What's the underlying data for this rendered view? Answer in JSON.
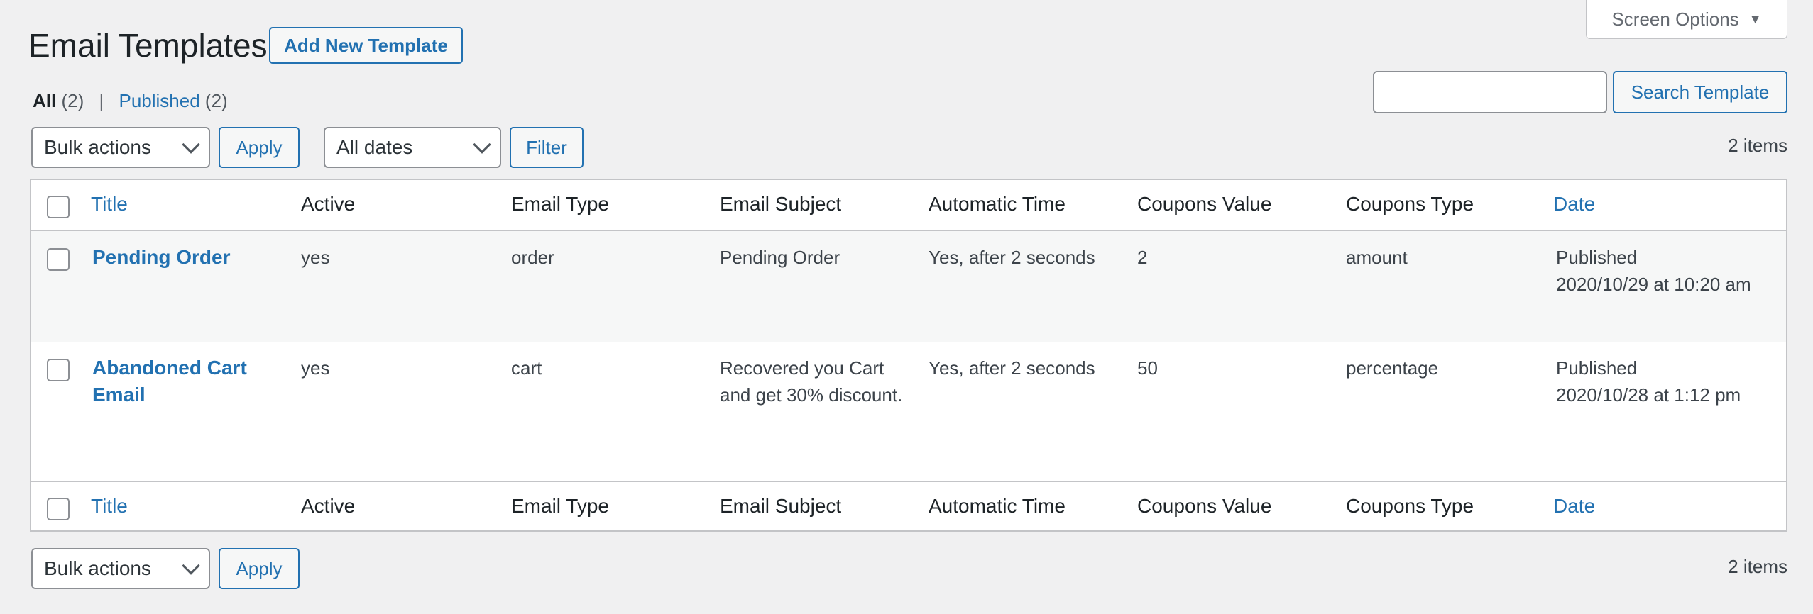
{
  "screen_options": {
    "label": "Screen Options",
    "arrow": "▼"
  },
  "page": {
    "title": "Email Templates",
    "add_new_label": "Add New Template"
  },
  "views": {
    "all_label": "All",
    "all_count": "(2)",
    "separator": "|",
    "published_label": "Published",
    "published_count": "(2)"
  },
  "search": {
    "value": "",
    "button_label": "Search Template"
  },
  "tablenav_top": {
    "bulk_actions": "Bulk actions",
    "apply_label": "Apply",
    "dates_filter": "All dates",
    "filter_label": "Filter",
    "items_count": "2 items"
  },
  "table": {
    "columns": {
      "title": "Title",
      "active": "Active",
      "email_type": "Email Type",
      "email_subject": "Email Subject",
      "automatic_time": "Automatic Time",
      "coupons_value": "Coupons Value",
      "coupons_type": "Coupons Type",
      "date": "Date"
    },
    "rows": [
      {
        "title": "Pending Order",
        "active": "yes",
        "email_type": "order",
        "email_subject": "Pending Order",
        "automatic_time": "Yes, after 2 seconds",
        "coupons_value": "2",
        "coupons_type": "amount",
        "date_status": "Published",
        "date_value": "2020/10/29 at 10:20 am"
      },
      {
        "title": "Abandoned Cart Email",
        "active": "yes",
        "email_type": "cart",
        "email_subject": "Recovered you Cart and get 30% discount.",
        "automatic_time": "Yes, after 2 seconds",
        "coupons_value": "50",
        "coupons_type": "percentage",
        "date_status": "Published",
        "date_value": "2020/10/28 at 1:12 pm"
      }
    ]
  },
  "tablenav_bottom": {
    "bulk_actions": "Bulk actions",
    "apply_label": "Apply",
    "items_count": "2 items"
  },
  "colors": {
    "link": "#2271b1",
    "background": "#f0f0f1",
    "heading": "#1d2327"
  }
}
